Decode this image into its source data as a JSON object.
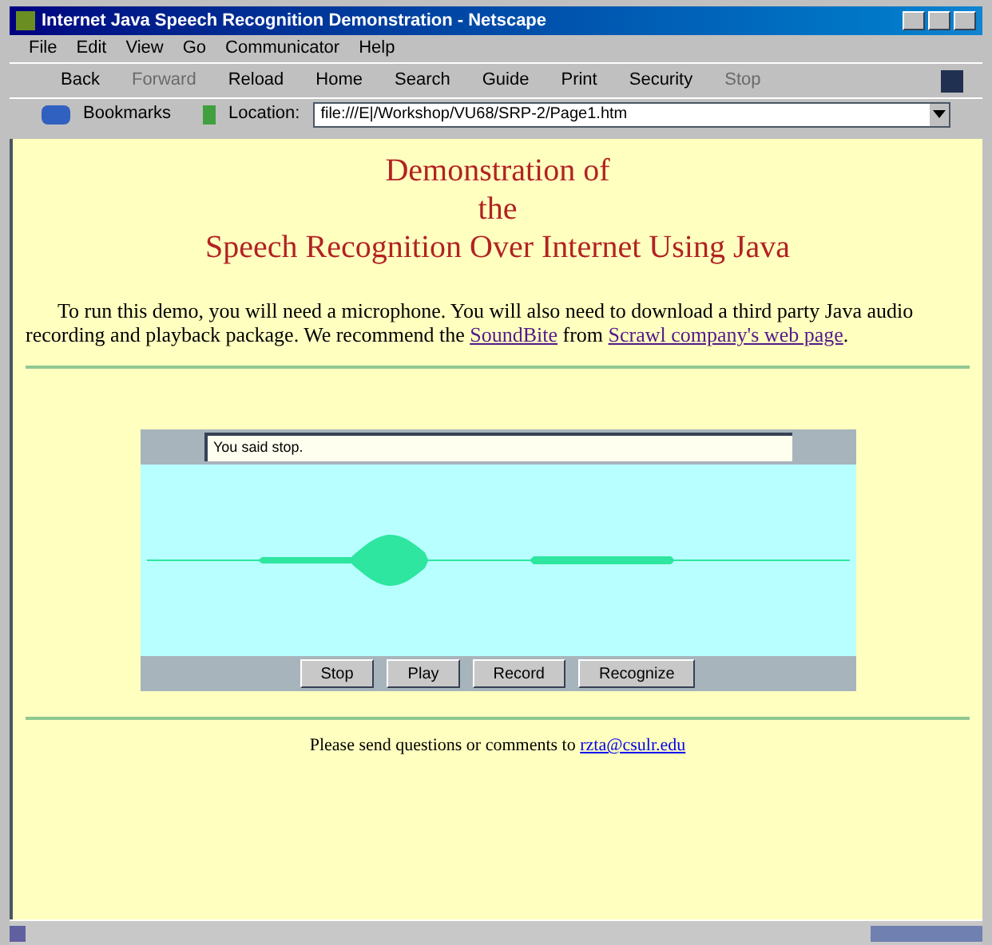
{
  "window": {
    "title": "Internet Java Speech Recognition Demonstration - Netscape"
  },
  "menu": [
    "File",
    "Edit",
    "View",
    "Go",
    "Communicator",
    "Help"
  ],
  "toolbar": [
    {
      "label": "Back",
      "disabled": false
    },
    {
      "label": "Forward",
      "disabled": true
    },
    {
      "label": "Reload",
      "disabled": false
    },
    {
      "label": "Home",
      "disabled": false
    },
    {
      "label": "Search",
      "disabled": false
    },
    {
      "label": "Guide",
      "disabled": false
    },
    {
      "label": "Print",
      "disabled": false
    },
    {
      "label": "Security",
      "disabled": false
    },
    {
      "label": "Stop",
      "disabled": true
    }
  ],
  "location_bar": {
    "bookmarks": "Bookmarks",
    "label": "Location:",
    "value": "file:///E|/Workshop/VU68/SRP-2/Page1.htm"
  },
  "page": {
    "heading": [
      "Demonstration of",
      "the",
      "Speech Recognition Over Internet Using Java"
    ],
    "intro": {
      "text": "To run this demo, you will need a microphone. You will also need to download a third party Java audio recording and playback package. We recommend the ",
      "link1": "SoundBite",
      "middle": " from ",
      "link2": "Scrawl company's web page",
      "end": "."
    },
    "applet": {
      "result": "You said stop.",
      "buttons": [
        "Stop",
        "Play",
        "Record",
        "Recognize"
      ]
    },
    "footer": {
      "text": "Please send questions or comments to ",
      "link": "rzta@csulr.edu"
    }
  }
}
